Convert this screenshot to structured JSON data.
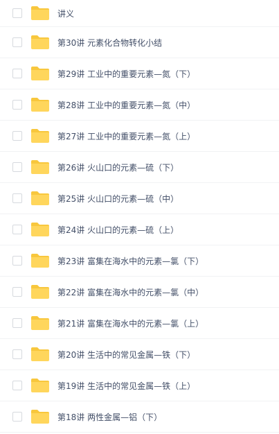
{
  "colors": {
    "folder_back": "#f8c73d",
    "folder_front": "#ffd65c",
    "text": "#424e67",
    "checkbox_border": "#d6d9de",
    "row_divider": "#f1f2f4"
  },
  "items": [
    {
      "name": "讲义",
      "icon": "folder-icon",
      "checked": false
    },
    {
      "name": "第30讲 元素化合物转化小结",
      "icon": "folder-icon",
      "checked": false
    },
    {
      "name": "第29讲 工业中的重要元素—氮（下）",
      "icon": "folder-icon",
      "checked": false
    },
    {
      "name": "第28讲 工业中的重要元素—氮（中）",
      "icon": "folder-icon",
      "checked": false
    },
    {
      "name": "第27讲 工业中的重要元素—氮（上）",
      "icon": "folder-icon",
      "checked": false
    },
    {
      "name": "第26讲 火山口的元素—硫（下）",
      "icon": "folder-icon",
      "checked": false
    },
    {
      "name": "第25讲 火山口的元素—硫（中）",
      "icon": "folder-icon",
      "checked": false
    },
    {
      "name": "第24讲 火山口的元素—硫（上）",
      "icon": "folder-icon",
      "checked": false
    },
    {
      "name": "第23讲 富集在海水中的元素—氯（下）",
      "icon": "folder-icon",
      "checked": false
    },
    {
      "name": "第22讲 富集在海水中的元素—氯（中）",
      "icon": "folder-icon",
      "checked": false
    },
    {
      "name": "第21讲 富集在海水中的元素—氯（上）",
      "icon": "folder-icon",
      "checked": false
    },
    {
      "name": "第20讲 生活中的常见金属—铁（下）",
      "icon": "folder-icon",
      "checked": false
    },
    {
      "name": "第19讲 生活中的常见金属—铁（上）",
      "icon": "folder-icon",
      "checked": false
    },
    {
      "name": "第18讲 两性金属—铝（下）",
      "icon": "folder-icon",
      "checked": false
    }
  ]
}
